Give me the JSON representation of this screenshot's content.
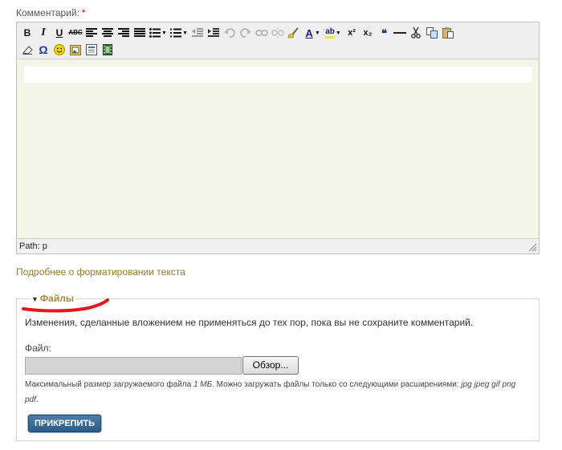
{
  "comment": {
    "label": "Комментарий:",
    "required_mark": "*"
  },
  "editor": {
    "toolbar_row1": [
      {
        "name": "bold",
        "glyph": "B"
      },
      {
        "name": "italic",
        "glyph": "I"
      },
      {
        "name": "underline",
        "glyph": "U"
      },
      {
        "name": "strikethrough",
        "glyph": "ABC"
      },
      {
        "name": "align-left"
      },
      {
        "name": "align-center"
      },
      {
        "name": "align-right"
      },
      {
        "name": "align-justify"
      },
      {
        "name": "bullet-list"
      },
      {
        "name": "numbered-list"
      },
      {
        "name": "outdent"
      },
      {
        "name": "indent"
      },
      {
        "name": "undo",
        "disabled": true
      },
      {
        "name": "redo",
        "disabled": true
      },
      {
        "name": "link",
        "disabled": true
      },
      {
        "name": "unlink",
        "disabled": true
      },
      {
        "name": "cleanup"
      },
      {
        "name": "font-color",
        "glyph": "A"
      },
      {
        "name": "highlight-color",
        "glyph": "ab"
      },
      {
        "name": "superscript",
        "glyph": "x²"
      },
      {
        "name": "subscript",
        "glyph": "x₂"
      },
      {
        "name": "blockquote",
        "glyph": "66"
      },
      {
        "name": "horizontal-rule"
      },
      {
        "name": "cut"
      },
      {
        "name": "copy"
      },
      {
        "name": "paste"
      }
    ],
    "toolbar_row2": [
      {
        "name": "remove-format"
      },
      {
        "name": "special-char",
        "glyph": "Ω"
      },
      {
        "name": "emotions"
      },
      {
        "name": "insert-image"
      },
      {
        "name": "insert-doc"
      },
      {
        "name": "insert-media"
      }
    ],
    "path_label": "Path: p"
  },
  "format_link": "Подробнее о форматировании текста",
  "files": {
    "legend": "Файлы",
    "description": "Изменения, сделанные вложением не применяться до тех пор, пока вы не сохраните комментарий.",
    "file_label": "Файл:",
    "file_value": "",
    "browse_label": "Обзор...",
    "hint_prefix": "Максимальный размер загружаемого файла",
    "hint_size": "1 МБ",
    "hint_middle": ". Можно загружать файлы только со следующими расширениями:",
    "hint_extensions": "jpg jpeg gif png pdf",
    "hint_suffix": ".",
    "attach_label": "ПРИКРЕПИТЬ"
  },
  "colors": {
    "link": "#9a7a2a",
    "legend": "#a88a3a",
    "attach_button": "#2c5d88",
    "annotation_stroke": "#e8151b",
    "edit_area": "#f3f5e6"
  }
}
